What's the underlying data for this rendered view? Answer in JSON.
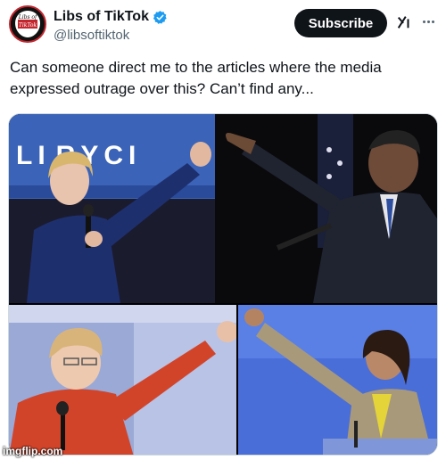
{
  "author": {
    "display_name": "Libs of TikTok",
    "handle": "@libsoftiktok",
    "avatar_text_line1": "Libs of",
    "avatar_text_line2": "TikTok"
  },
  "actions": {
    "subscribe_label": "Subscribe"
  },
  "tweet": {
    "text": "Can someone direct me to the articles where the media expressed outrage over this? Can’t find any..."
  },
  "media": {
    "sign_text": "L I  R Y C I"
  },
  "watermark": "imgflip.com",
  "colors": {
    "verified": "#1d9bf0",
    "subscribe_bg": "#0f1419",
    "handle": "#536471"
  },
  "icons": [
    "verified-badge-icon",
    "grok-icon",
    "more-options-icon"
  ]
}
